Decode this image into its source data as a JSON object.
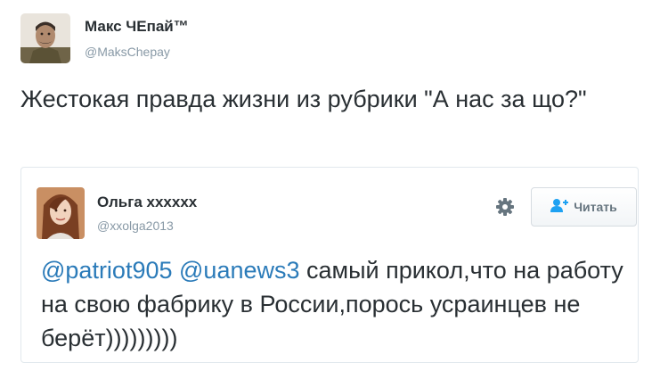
{
  "tweet": {
    "author_name": "Макс ЧЕпай™",
    "author_handle": "@MaksChepay",
    "text": "Жестокая правда жизни из рубрики \"А нас за що?\""
  },
  "quoted_tweet": {
    "author_name": "Ольга xxxxxx",
    "author_handle": "@xxolga2013",
    "follow_label": "Читать",
    "mention_1": "@patriot905",
    "mention_2": "@uanews3",
    "text_rest": " самый прикол,что на работу на свою фабрику в России,порось усраинцев не берёт)))))))))"
  },
  "icons": {
    "main_avatar": "avatar-photo",
    "quote_avatar": "avatar-photo",
    "settings": "gear-icon",
    "follow": "add-user-icon"
  },
  "colors": {
    "link": "#2b7bb9",
    "muted": "#8899a6",
    "text": "#292f33",
    "border": "#e1e8ed"
  }
}
